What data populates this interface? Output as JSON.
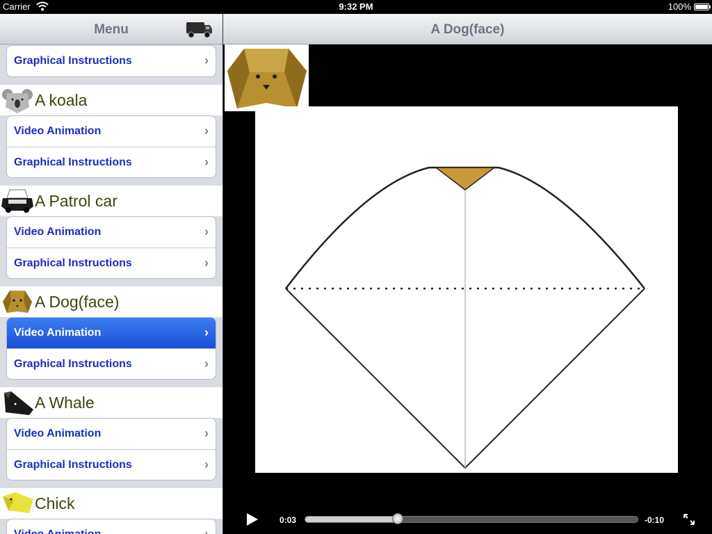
{
  "status": {
    "carrier": "Carrier",
    "time": "9:32 PM",
    "battery": "100%"
  },
  "menu": {
    "title": "Menu",
    "action_icon": "truck-icon"
  },
  "top_group": [
    {
      "label": "Graphical Instructions"
    }
  ],
  "sections": [
    {
      "name": "A koala",
      "icon": "koala-icon",
      "items": [
        {
          "label": "Video Animation"
        },
        {
          "label": "Graphical Instructions"
        }
      ]
    },
    {
      "name": "A Patrol car",
      "icon": "patrol-car-icon",
      "items": [
        {
          "label": "Video Animation"
        },
        {
          "label": "Graphical Instructions"
        }
      ]
    },
    {
      "name": "A Dog(face)",
      "icon": "dog-face-icon",
      "items": [
        {
          "label": "Video Animation",
          "selected": true
        },
        {
          "label": "Graphical Instructions"
        }
      ]
    },
    {
      "name": "A Whale",
      "icon": "whale-icon",
      "items": [
        {
          "label": "Video Animation"
        },
        {
          "label": "Graphical Instructions"
        }
      ]
    },
    {
      "name": "Chick",
      "icon": "chick-icon",
      "items": [
        {
          "label": "Video Animation"
        }
      ]
    }
  ],
  "detail": {
    "title": "A Dog(face)"
  },
  "player": {
    "elapsed": "0:03",
    "remaining": "-0:10",
    "progress": 0.28
  },
  "colors": {
    "selection": "#1a4fd6",
    "link_blue": "#1a2fb8",
    "section_text": "#3c4610",
    "origami_tan": "#c89a3a"
  }
}
